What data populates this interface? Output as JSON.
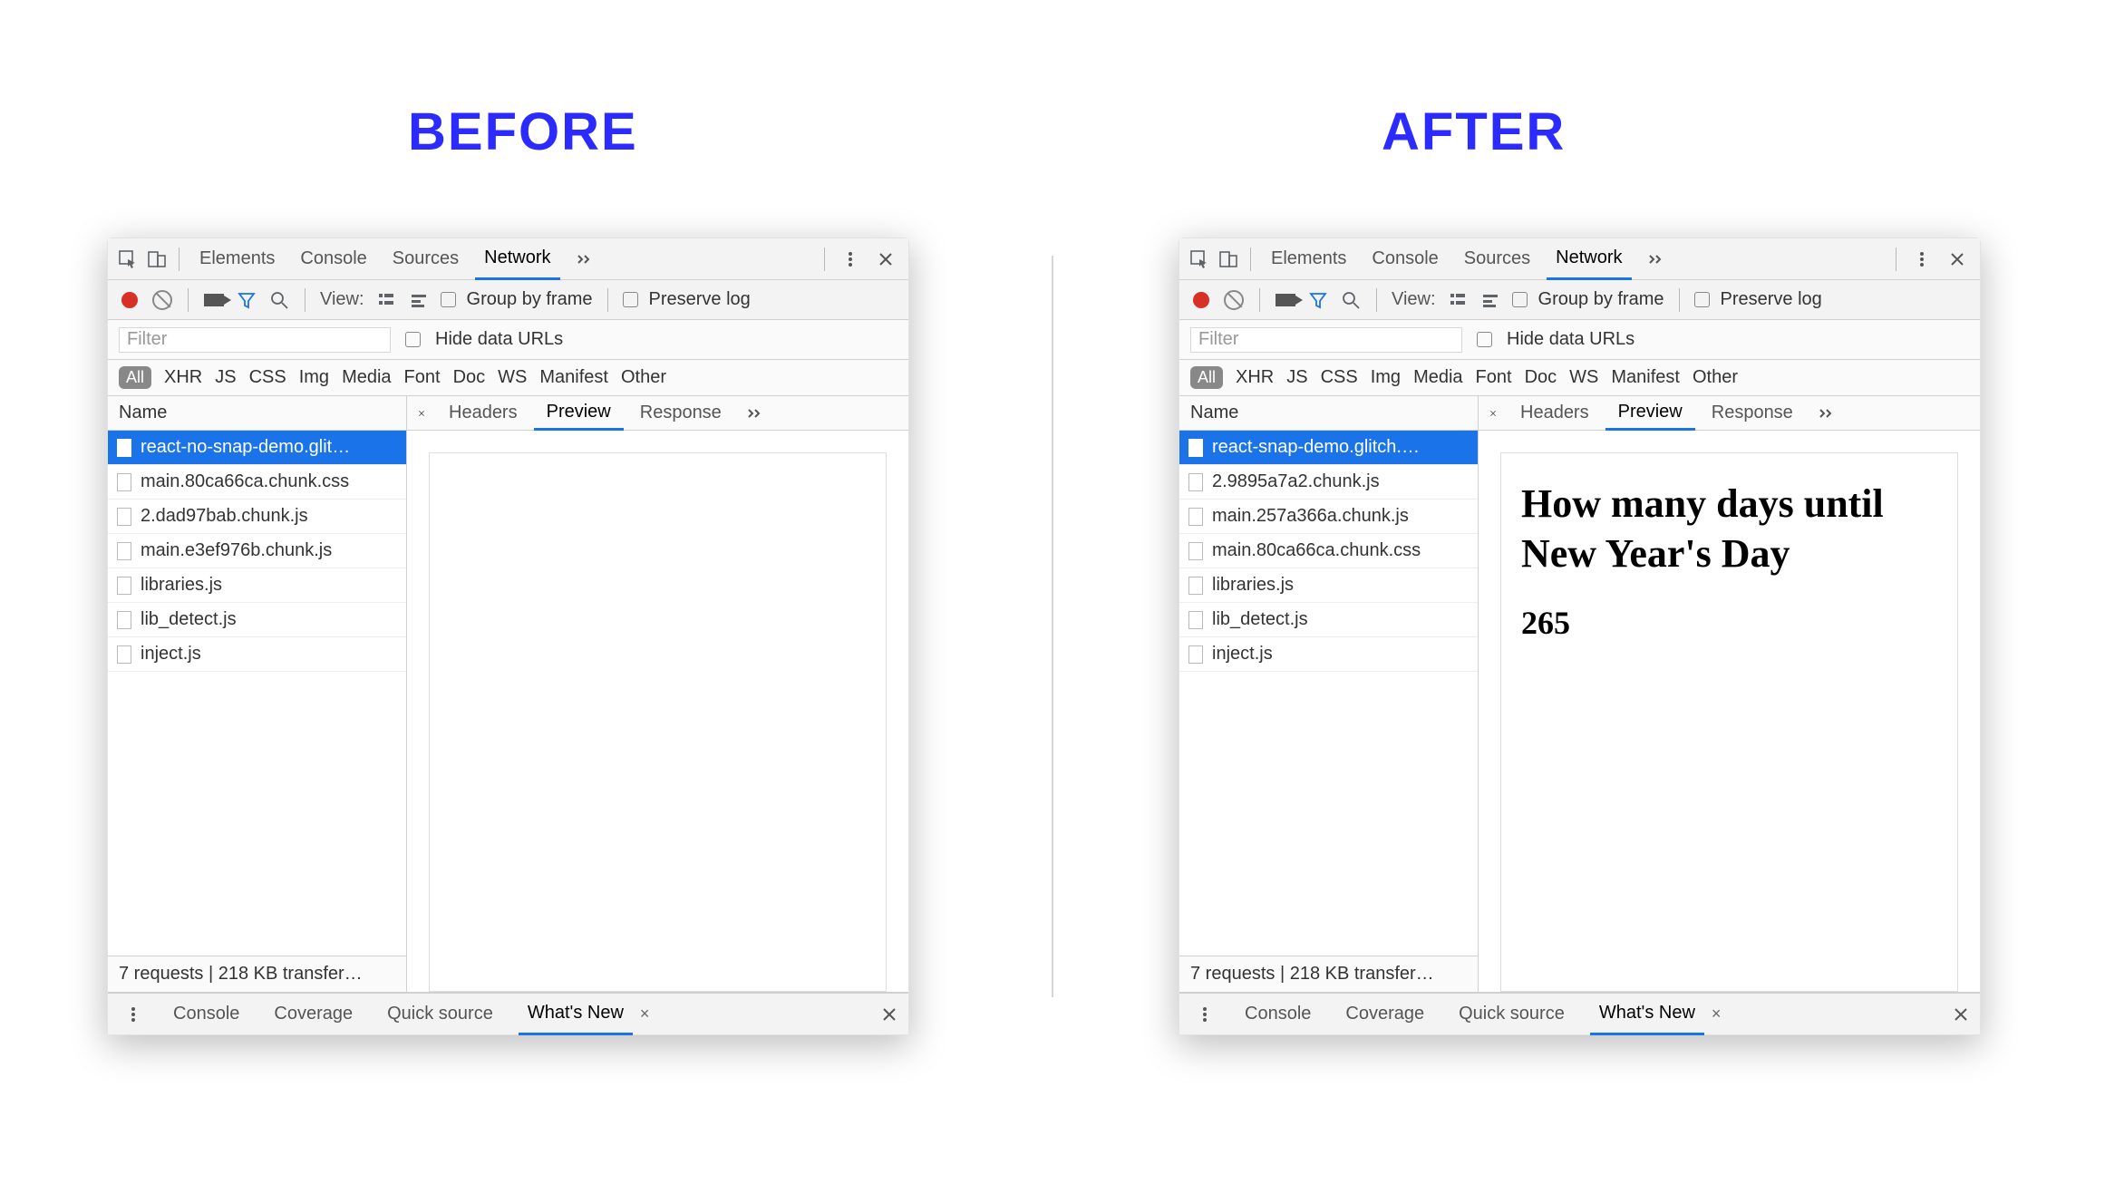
{
  "headings": {
    "before": "BEFORE",
    "after": "AFTER"
  },
  "devtools": {
    "top_tabs": [
      "Elements",
      "Console",
      "Sources",
      "Network"
    ],
    "top_active": "Network",
    "toolbar": {
      "view_label": "View:",
      "group_by_frame": "Group by frame",
      "preserve_log": "Preserve log"
    },
    "filter": {
      "placeholder": "Filter",
      "hide_data_urls": "Hide data URLs"
    },
    "type_filters": [
      "All",
      "XHR",
      "JS",
      "CSS",
      "Img",
      "Media",
      "Font",
      "Doc",
      "WS",
      "Manifest",
      "Other"
    ],
    "type_active": "All",
    "name_header": "Name",
    "detail_tabs": [
      "Headers",
      "Preview",
      "Response"
    ],
    "detail_active": "Preview",
    "status": "7 requests | 218 KB transfer…",
    "drawer_tabs": [
      "Console",
      "Coverage",
      "Quick source",
      "What's New"
    ],
    "drawer_active": "What's New"
  },
  "before": {
    "requests": [
      "react-no-snap-demo.glit…",
      "main.80ca66ca.chunk.css",
      "2.dad97bab.chunk.js",
      "main.e3ef976b.chunk.js",
      "libraries.js",
      "lib_detect.js",
      "inject.js"
    ],
    "selected_index": 0,
    "preview": {
      "show": false
    }
  },
  "after": {
    "requests": [
      "react-snap-demo.glitch.…",
      "2.9895a7a2.chunk.js",
      "main.257a366a.chunk.js",
      "main.80ca66ca.chunk.css",
      "libraries.js",
      "lib_detect.js",
      "inject.js"
    ],
    "selected_index": 0,
    "preview": {
      "show": true,
      "heading": "How many days until New Year's Day",
      "value": "265"
    }
  }
}
